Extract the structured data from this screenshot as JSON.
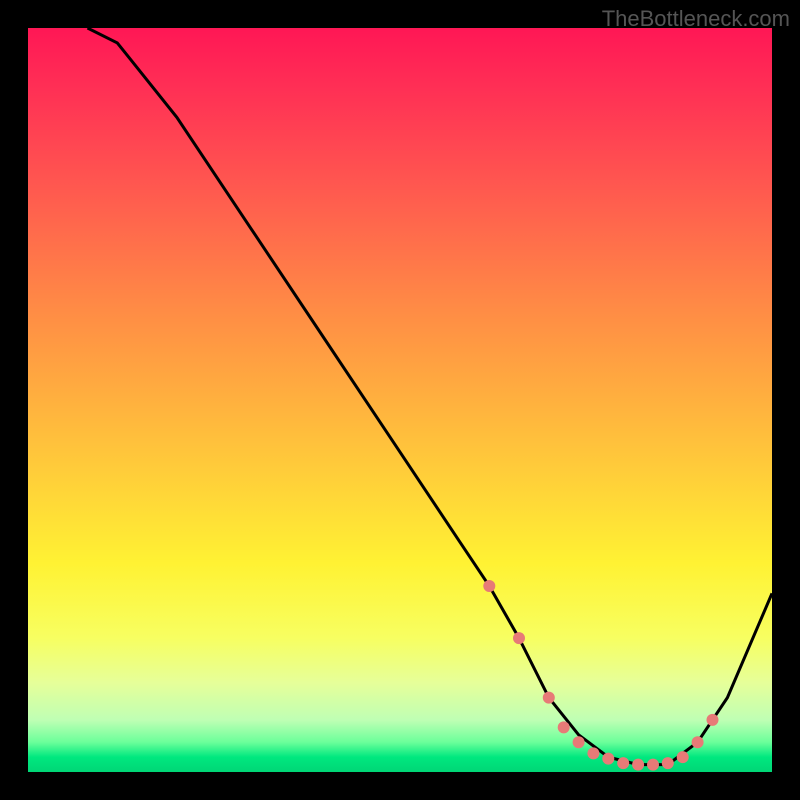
{
  "watermark": "TheBottleneck.com",
  "chart_data": {
    "type": "line",
    "title": "",
    "xlabel": "",
    "ylabel": "",
    "xlim": [
      0,
      100
    ],
    "ylim": [
      0,
      100
    ],
    "series": [
      {
        "name": "curve",
        "x": [
          8,
          12,
          20,
          30,
          40,
          50,
          58,
          62,
          66,
          70,
          74,
          78,
          82,
          86,
          90,
          94,
          100
        ],
        "y": [
          100,
          98,
          88,
          73,
          58,
          43,
          31,
          25,
          18,
          10,
          5,
          2,
          1,
          1,
          4,
          10,
          24
        ]
      }
    ],
    "markers": {
      "name": "highlight-dots",
      "x": [
        62,
        66,
        70,
        72,
        74,
        76,
        78,
        80,
        82,
        84,
        86,
        88,
        90,
        92
      ],
      "y": [
        25,
        18,
        10,
        6,
        4,
        2.5,
        1.8,
        1.2,
        1,
        1,
        1.2,
        2,
        4,
        7
      ]
    },
    "gradient_stops": [
      {
        "pos": 0,
        "color": "#ff1755"
      },
      {
        "pos": 8,
        "color": "#ff2f55"
      },
      {
        "pos": 22,
        "color": "#ff5a4f"
      },
      {
        "pos": 38,
        "color": "#ff8c45"
      },
      {
        "pos": 55,
        "color": "#ffbf3c"
      },
      {
        "pos": 72,
        "color": "#fff233"
      },
      {
        "pos": 82,
        "color": "#f7ff61"
      },
      {
        "pos": 88,
        "color": "#e6ff99"
      },
      {
        "pos": 93,
        "color": "#bfffb4"
      },
      {
        "pos": 96,
        "color": "#6bff9a"
      },
      {
        "pos": 98,
        "color": "#00e87f"
      },
      {
        "pos": 100,
        "color": "#00d676"
      }
    ],
    "colors": {
      "curve": "#000000",
      "marker": "#E77A77",
      "background_frame": "#000000"
    }
  }
}
